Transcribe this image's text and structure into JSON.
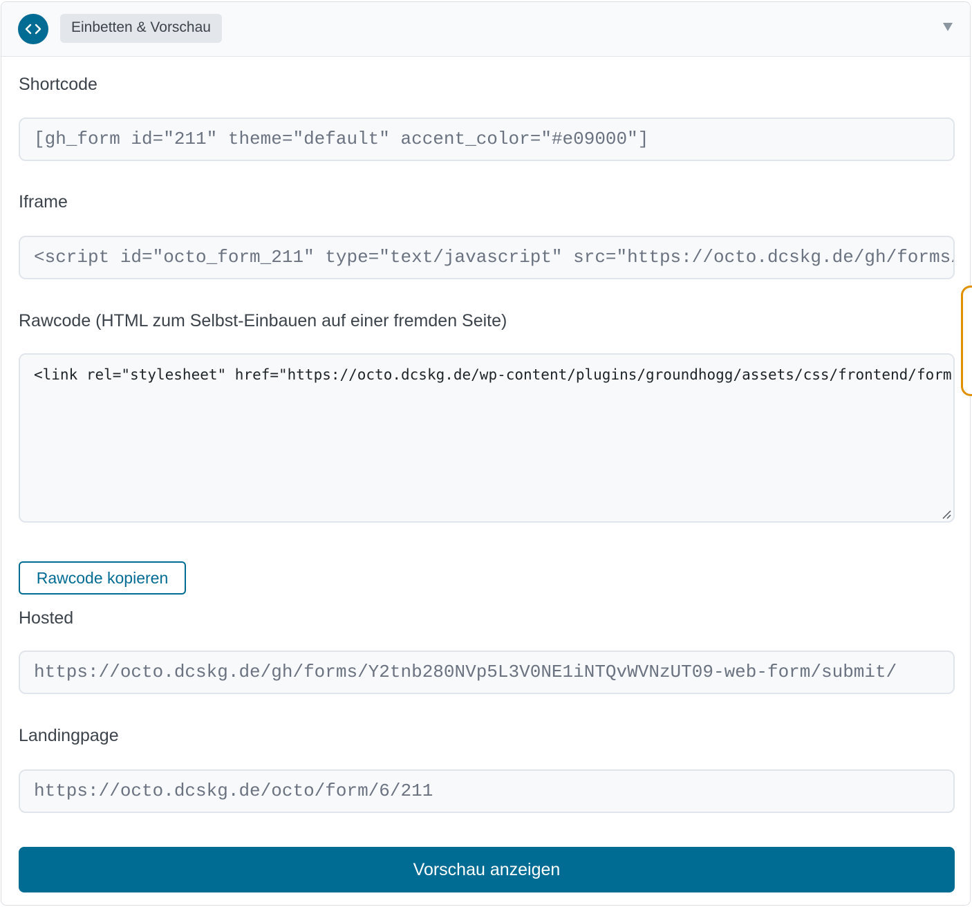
{
  "header": {
    "icon": "code-brackets-icon",
    "tag_label": "Einbetten & Vorschau",
    "toggle_icon": "caret-down-icon"
  },
  "shortcode": {
    "label": "Shortcode",
    "value": "[gh_form id=\"211\" theme=\"default\" accent_color=\"#e09000\"]"
  },
  "iframe": {
    "label": "Iframe",
    "value": "<script id=\"octo_form_211\" type=\"text/javascript\" src=\"https://octo.dcskg.de/gh/forms/"
  },
  "rawcode": {
    "label": "Rawcode (HTML zum Selbst-Einbauen auf einer fremden Seite)",
    "value": "<link rel=\"stylesheet\" href=\"https://octo.dcskg.de/wp-content/plugins/groundhogg/assets/css/frontend/form.css\">",
    "copy_label": "Rawcode kopieren"
  },
  "hosted": {
    "label": "Hosted",
    "value": "https://octo.dcskg.de/gh/forms/Y2tnb280NVp5L3V0NE1iNTQvWVNzUT09-web-form/submit/"
  },
  "landingpage": {
    "label": "Landingpage",
    "value": "https://octo.dcskg.de/octo/form/6/211"
  },
  "preview": {
    "label": "Vorschau anzeigen"
  },
  "colors": {
    "primary": "#006b93",
    "accent": "#e09000",
    "field_bg": "#f7f9fb",
    "border": "#e0e5eb"
  }
}
